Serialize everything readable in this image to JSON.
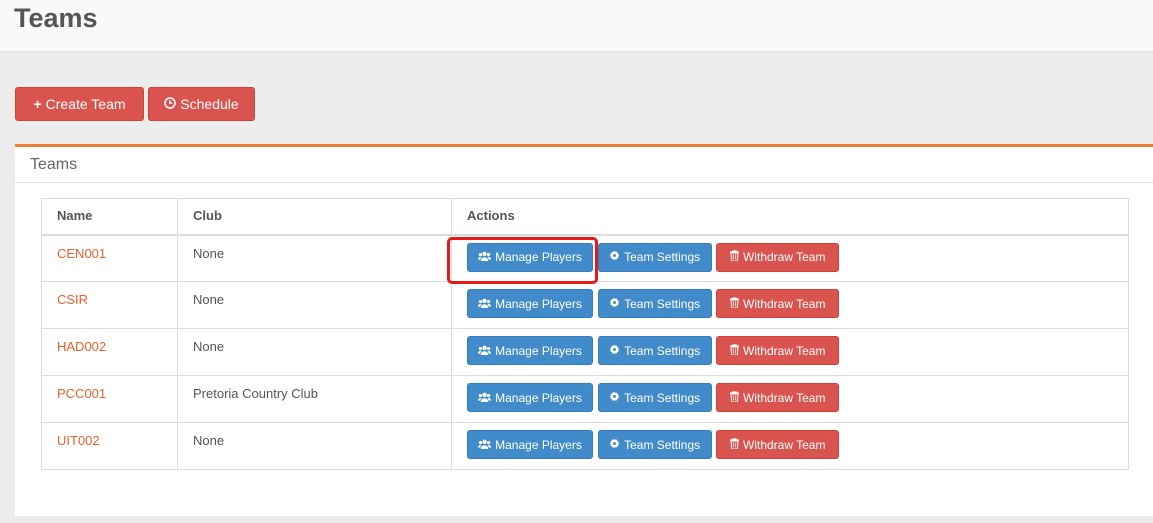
{
  "page": {
    "title": "Teams"
  },
  "toolbar": {
    "create_team_label": "Create Team",
    "create_team_icon": "plus-icon",
    "schedule_label": "Schedule",
    "schedule_icon": "clock-icon"
  },
  "panel": {
    "title": "Teams"
  },
  "table": {
    "headers": {
      "name": "Name",
      "club": "Club",
      "actions": "Actions"
    },
    "rows": [
      {
        "name": "CEN001",
        "club": "None"
      },
      {
        "name": "CSIR",
        "club": "None"
      },
      {
        "name": "HAD002",
        "club": "None"
      },
      {
        "name": "PCC001",
        "club": "Pretoria Country Club"
      },
      {
        "name": "UIT002",
        "club": "None"
      }
    ],
    "actions": {
      "manage_players": "Manage Players",
      "team_settings": "Team Settings",
      "withdraw_team": "Withdraw Team"
    },
    "highlighted_row": 0
  },
  "colors": {
    "accent": "#f07d34",
    "link": "#e8612c",
    "danger": "#d9534f",
    "primary": "#428bca",
    "highlight": "#e8191a"
  }
}
